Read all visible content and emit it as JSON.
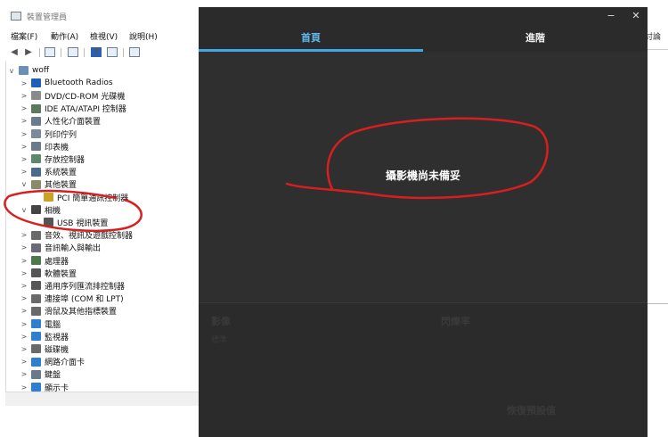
{
  "device_manager": {
    "title": "裝置管理員",
    "menu": [
      "檔案(F)",
      "動作(A)",
      "檢視(V)",
      "說明(H)"
    ],
    "tree": [
      {
        "label": "woff",
        "arrow": "v",
        "color": "#6b8fb5",
        "icon": "computer-icon"
      },
      {
        "label": "Bluetooth Radios",
        "arrow": ">",
        "color": "#1f5fb8",
        "icon": "bluetooth-icon"
      },
      {
        "label": "DVD/CD-ROM 光碟機",
        "arrow": ">",
        "color": "#8a8a8a",
        "icon": "dvd-drive-icon"
      },
      {
        "label": "IDE ATA/ATAPI 控制器",
        "arrow": ">",
        "color": "#5a7a5a",
        "icon": "ide-controller-icon"
      },
      {
        "label": "人性化介面裝置",
        "arrow": ">",
        "color": "#6b7a8a",
        "icon": "hid-icon"
      },
      {
        "label": "列印佇列",
        "arrow": ">",
        "color": "#7a8a9a",
        "icon": "print-queue-icon"
      },
      {
        "label": "印表機",
        "arrow": ">",
        "color": "#6a7a8a",
        "icon": "printer-icon"
      },
      {
        "label": "存放控制器",
        "arrow": ">",
        "color": "#5a8a6a",
        "icon": "storage-controller-icon"
      },
      {
        "label": "系統裝置",
        "arrow": ">",
        "color": "#4a6a8a",
        "icon": "system-device-icon"
      },
      {
        "label": "其他裝置",
        "arrow": "v",
        "color": "#8a8a6a",
        "icon": "other-device-icon"
      },
      {
        "label": "PCI 簡單通訊控制器",
        "arrow": "",
        "color": "#c9a227",
        "icon": "warning-device-icon"
      },
      {
        "label": "相機",
        "arrow": "v",
        "color": "#444444",
        "icon": "camera-icon"
      },
      {
        "label": "USB 視訊裝置",
        "arrow": "",
        "color": "#555555",
        "icon": "webcam-icon"
      },
      {
        "label": "音效、視訊及遊戲控制器",
        "arrow": ">",
        "color": "#6a6a6a",
        "icon": "audio-icon"
      },
      {
        "label": "音訊輸入與輸出",
        "arrow": ">",
        "color": "#6a6a7a",
        "icon": "audio-io-icon"
      },
      {
        "label": "處理器",
        "arrow": ">",
        "color": "#4a7a4a",
        "icon": "processor-icon"
      },
      {
        "label": "軟體裝置",
        "arrow": ">",
        "color": "#555555",
        "icon": "software-device-icon"
      },
      {
        "label": "通用序列匯流排控制器",
        "arrow": ">",
        "color": "#555555",
        "icon": "usb-controller-icon"
      },
      {
        "label": "連接埠 (COM 和 LPT)",
        "arrow": ">",
        "color": "#6a6a6a",
        "icon": "port-icon"
      },
      {
        "label": "滑鼠及其他指標裝置",
        "arrow": ">",
        "color": "#6a6a6a",
        "icon": "mouse-icon"
      },
      {
        "label": "電腦",
        "arrow": ">",
        "color": "#2f7fd0",
        "icon": "pc-icon"
      },
      {
        "label": "監視器",
        "arrow": ">",
        "color": "#2f7fd0",
        "icon": "monitor-icon"
      },
      {
        "label": "磁碟機",
        "arrow": ">",
        "color": "#6a6a6a",
        "icon": "disk-drive-icon"
      },
      {
        "label": "網路介面卡",
        "arrow": ">",
        "color": "#2f7fd0",
        "icon": "network-adapter-icon"
      },
      {
        "label": "鍵盤",
        "arrow": ">",
        "color": "#6a7a8a",
        "icon": "keyboard-icon"
      },
      {
        "label": "顯示卡",
        "arrow": ">",
        "color": "#2f7fd0",
        "icon": "display-adapter-icon"
      }
    ],
    "right_partial_text": "討論"
  },
  "camera_app": {
    "window_buttons": {
      "minimize": "−",
      "close": "✕"
    },
    "tabs": [
      "首頁",
      "進階"
    ],
    "status_text": "攝影機尚未備妥",
    "bottom": {
      "left_section": "影像",
      "right_section": "閃爍率",
      "fields": [
        "標準",
        "",
        "",
        ""
      ],
      "button": "恢復預設值"
    }
  },
  "colors": {
    "accent": "#3fa7e6",
    "annotation": "#d81f1f",
    "app_background": "#2b2b2b"
  }
}
